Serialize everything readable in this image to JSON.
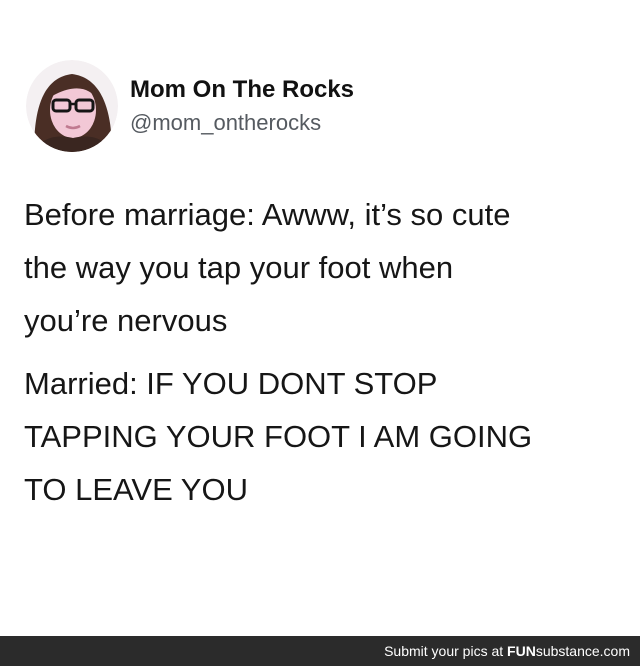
{
  "tweet": {
    "author": {
      "display_name": "Mom On The Rocks",
      "handle": "@mom_ontherocks",
      "avatar_icon": "profile-photo-icon"
    },
    "lines": [
      "Before marriage: Awww, it’s so cute",
      "the way you tap your foot when",
      "you’re nervous",
      "Married: IF YOU DONT STOP",
      "TAPPING YOUR FOOT I AM GOING",
      "TO LEAVE YOU"
    ]
  },
  "footer": {
    "submit_text": "Submit your pics at",
    "brand_part1": "FUN",
    "brand_part2": "substance",
    "brand_suffix": ".com",
    "background_color": "#2b2b2b"
  }
}
